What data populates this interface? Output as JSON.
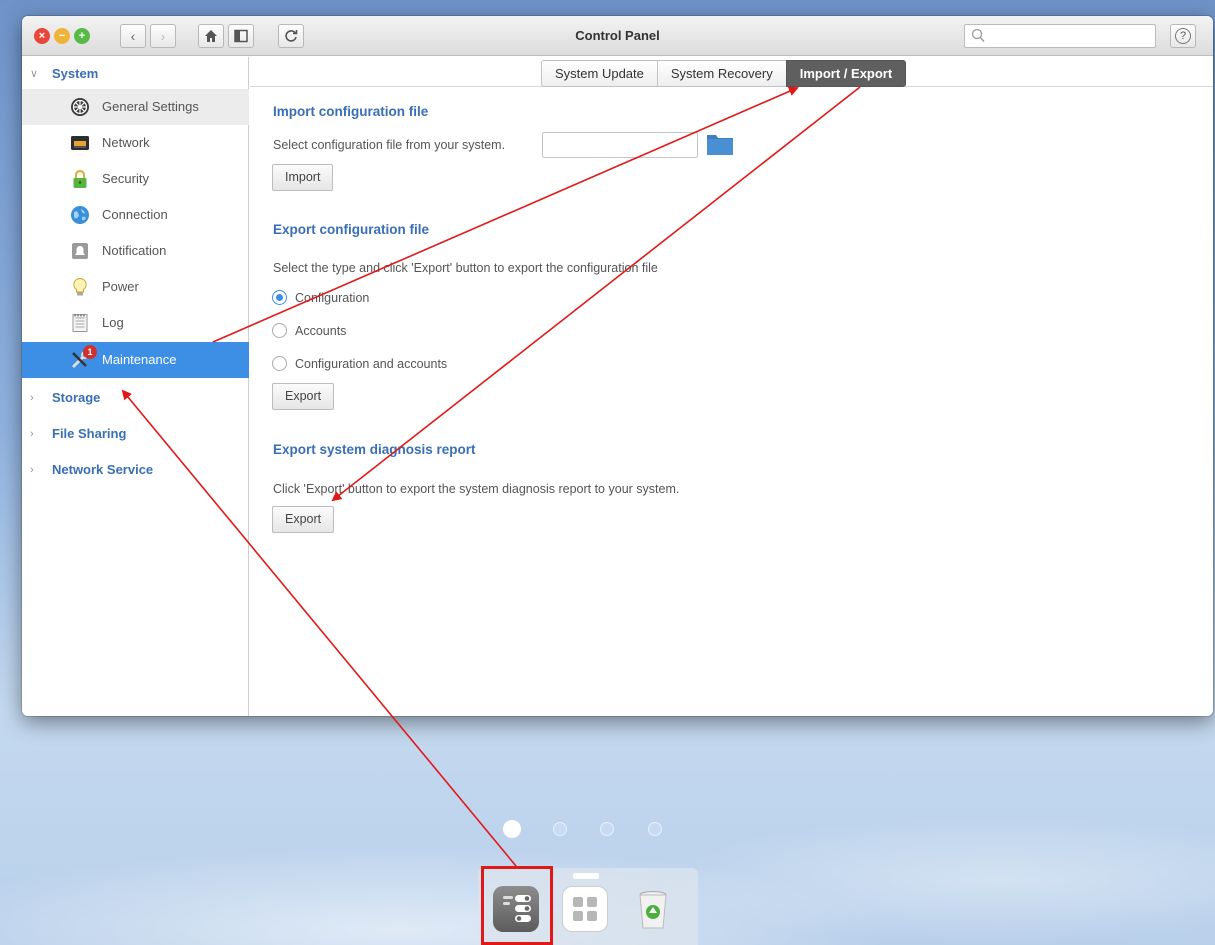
{
  "window": {
    "title": "Control Panel",
    "search_placeholder": "",
    "help_label": "?"
  },
  "titlebar_icons": [
    "close-icon",
    "minimize-icon",
    "maximize-icon",
    "back-icon",
    "forward-icon",
    "home-icon",
    "sidebar-toggle-icon",
    "refresh-icon",
    "search-icon",
    "help-icon"
  ],
  "sidebar": {
    "categories": [
      {
        "label": "System",
        "expanded": true
      },
      {
        "label": "Storage",
        "expanded": false
      },
      {
        "label": "File Sharing",
        "expanded": false
      },
      {
        "label": "Network Service",
        "expanded": false
      }
    ],
    "items": [
      {
        "label": "General Settings",
        "icon": "gear-icon"
      },
      {
        "label": "Network",
        "icon": "network-icon"
      },
      {
        "label": "Security",
        "icon": "lock-icon"
      },
      {
        "label": "Connection",
        "icon": "globe-icon"
      },
      {
        "label": "Notification",
        "icon": "bell-icon"
      },
      {
        "label": "Power",
        "icon": "bulb-icon"
      },
      {
        "label": "Log",
        "icon": "log-icon"
      },
      {
        "label": "Maintenance",
        "icon": "tools-icon",
        "badge": "1",
        "active": true
      }
    ]
  },
  "tabs": [
    {
      "label": "System Update",
      "active": false
    },
    {
      "label": "System Recovery",
      "active": false
    },
    {
      "label": "Import / Export",
      "active": true
    }
  ],
  "import_section": {
    "title": "Import configuration file",
    "description": "Select configuration file from your system.",
    "file_value": "",
    "button": "Import"
  },
  "export_section": {
    "title": "Export configuration file",
    "description": "Select the type and click 'Export' button to export the configuration file",
    "options": [
      {
        "label": "Configuration",
        "checked": true
      },
      {
        "label": "Accounts",
        "checked": false
      },
      {
        "label": "Configuration and accounts",
        "checked": false
      }
    ],
    "button": "Export"
  },
  "diagnosis_section": {
    "title": "Export system diagnosis report",
    "description": "Click 'Export' button to export the system diagnosis report to your system.",
    "button": "Export"
  },
  "dock": {
    "pages": 4,
    "active_page": 1,
    "apps": [
      {
        "name": "control-panel",
        "highlighted": true
      },
      {
        "name": "app-center",
        "highlighted": false
      },
      {
        "name": "recycle-bin",
        "highlighted": false
      }
    ]
  },
  "colors": {
    "accent": "#3d8fe6",
    "section_title": "#3a6fb5",
    "annotation": "#e01818"
  }
}
